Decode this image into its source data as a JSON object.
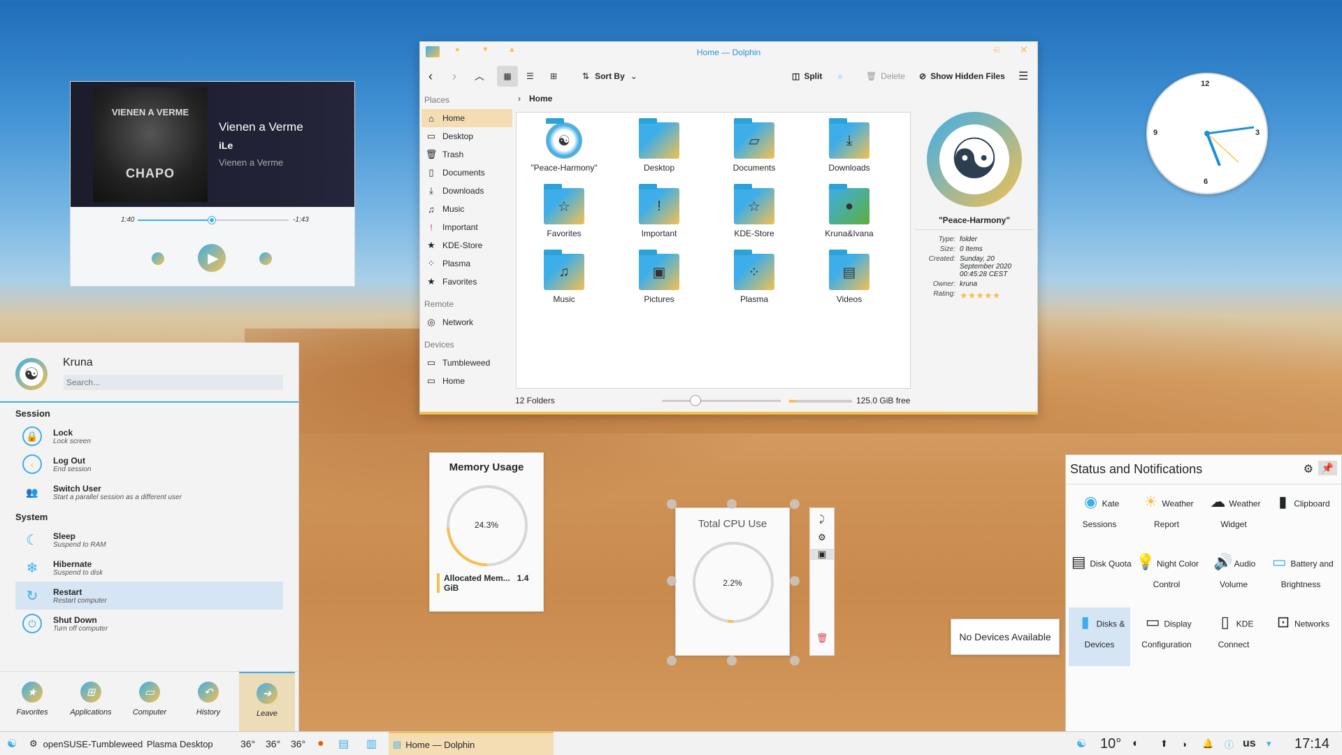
{
  "media": {
    "title": "Vienen a Verme",
    "artist": "iLe",
    "album": "Vienen a Verme",
    "cover_top": "VIENEN A VERME",
    "cover_bottom": "CHAPO",
    "elapsed": "1:40",
    "remaining": "-1:43",
    "progress": 0.49
  },
  "dolphin": {
    "window_title": "Home — Dolphin",
    "sort_label": "Sort By",
    "split_label": "Split",
    "delete_label": "Delete",
    "hidden_label": "Show Hidden Files",
    "places_header": "Places",
    "remote_header": "Remote",
    "devices_header": "Devices",
    "places": [
      "Home",
      "Desktop",
      "Trash",
      "Documents",
      "Downloads",
      "Music",
      "Important",
      "KDE-Store",
      "Plasma",
      "Favorites"
    ],
    "remote": [
      "Network"
    ],
    "devices": [
      "Tumbleweed",
      "Home"
    ],
    "breadcrumb": "Home",
    "folders": [
      "\"Peace-Harmony\"",
      "Desktop",
      "Documents",
      "Downloads",
      "Favorites",
      "Important",
      "KDE-Store",
      "Kruna&Ivana",
      "Music",
      "Pictures",
      "Plasma",
      "Videos"
    ],
    "info": {
      "name": "\"Peace-Harmony\"",
      "type_k": "Type:",
      "type": "folder",
      "size_k": "Size:",
      "size": "0 Items",
      "created_k": "Created:",
      "created": "Sunday, 20 September 2020 00:45:28 CEST",
      "owner_k": "Owner:",
      "owner": "kruna",
      "rating_k": "Rating:",
      "rating": "★★★★★"
    },
    "status_left": "12 Folders",
    "status_right": "125.0 GiB free"
  },
  "clock": {
    "n12": "12",
    "n3": "3",
    "n6": "6",
    "n9": "9"
  },
  "launcher": {
    "user": "Kruna",
    "search_placeholder": "Search...",
    "session": "Session",
    "system": "System",
    "items": [
      {
        "t": "Lock",
        "s": "Lock screen"
      },
      {
        "t": "Log Out",
        "s": "End session"
      },
      {
        "t": "Switch User",
        "s": "Start a parallel session as a different user"
      },
      {
        "t": "Sleep",
        "s": "Suspend to RAM"
      },
      {
        "t": "Hibernate",
        "s": "Suspend to disk"
      },
      {
        "t": "Restart",
        "s": "Restart computer"
      },
      {
        "t": "Shut Down",
        "s": "Turn off computer"
      }
    ],
    "tabs": [
      "Favorites",
      "Applications",
      "Computer",
      "History",
      "Leave"
    ]
  },
  "memory": {
    "title": "Memory Usage",
    "value": "24.3%",
    "legend": "Allocated Mem...",
    "amount": "1.4 GiB",
    "fraction": 0.243
  },
  "cpu": {
    "title": "Total CPU Use",
    "value": "2.2%",
    "fraction": 0.022
  },
  "notif": {
    "title": "Status and Notifications",
    "items": [
      "Kate Sessions",
      "Weather Report",
      "Weather Widget",
      "Clipboard",
      "Disk Quota",
      "Night Color Control",
      "Audio Volume",
      "Battery and Brightness",
      "Disks & Devices",
      "Display Configuration",
      "KDE Connect",
      "Networks"
    ],
    "popup": "No Devices Available"
  },
  "taskbar": {
    "distro": "openSUSE-Tumbleweed",
    "desktop": "Plasma Desktop",
    "temps": [
      "36°",
      "36°",
      "36°"
    ],
    "task": "Home — Dolphin",
    "weather": "10°",
    "layout": "us",
    "time": "17:14"
  }
}
